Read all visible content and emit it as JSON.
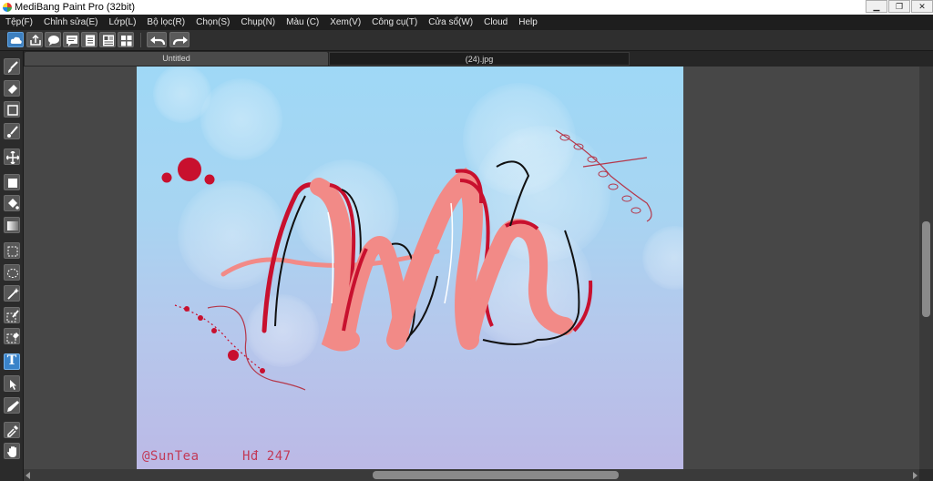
{
  "window": {
    "title": "MediBang Paint Pro (32bit)",
    "controls": [
      "minimize",
      "restore",
      "close"
    ]
  },
  "menu": [
    "Tệp(F)",
    "Chỉnh sửa(E)",
    "Lớp(L)",
    "Bộ lọc(R)",
    "Chọn(S)",
    "Chụp(N)",
    "Màu (C)",
    "Xem(V)",
    "Công cụ(T)",
    "Cửa sổ(W)",
    "Cloud",
    "Help"
  ],
  "toolbar": {
    "icons": [
      "cloud-icon",
      "share-icon",
      "speech-bubble-icon",
      "comment-icon",
      "page-icon",
      "layout-icon",
      "grid-icon",
      "undo-icon",
      "redo-icon"
    ]
  },
  "tools": {
    "icons": [
      "brush-icon",
      "eraser-icon",
      "rectangle-icon",
      "dot-brush-icon",
      "move-icon",
      "fill-rect-icon",
      "bucket-icon",
      "gradient-icon",
      "rect-select-icon",
      "lasso-icon",
      "magic-wand-icon",
      "select-pen-icon",
      "select-eraser-icon",
      "text-icon",
      "operation-icon",
      "pen-icon",
      "eyedropper-icon",
      "hand-icon"
    ],
    "text_tool_label": "T",
    "selected": "text-icon"
  },
  "tabs": [
    {
      "label": "Untitled",
      "active": true
    },
    {
      "label": "(24).jpg",
      "active": false
    }
  ],
  "canvas": {
    "artwork_text": "Anh",
    "watermark_left": "@SunTea",
    "watermark_right": "Hđ 247",
    "colors": {
      "sky_top": "#9fd8f6",
      "sky_bottom": "#bcb9e6",
      "ribbon_pink": "#f28a87",
      "ribbon_red": "#c8102e",
      "outline": "#111111"
    }
  }
}
